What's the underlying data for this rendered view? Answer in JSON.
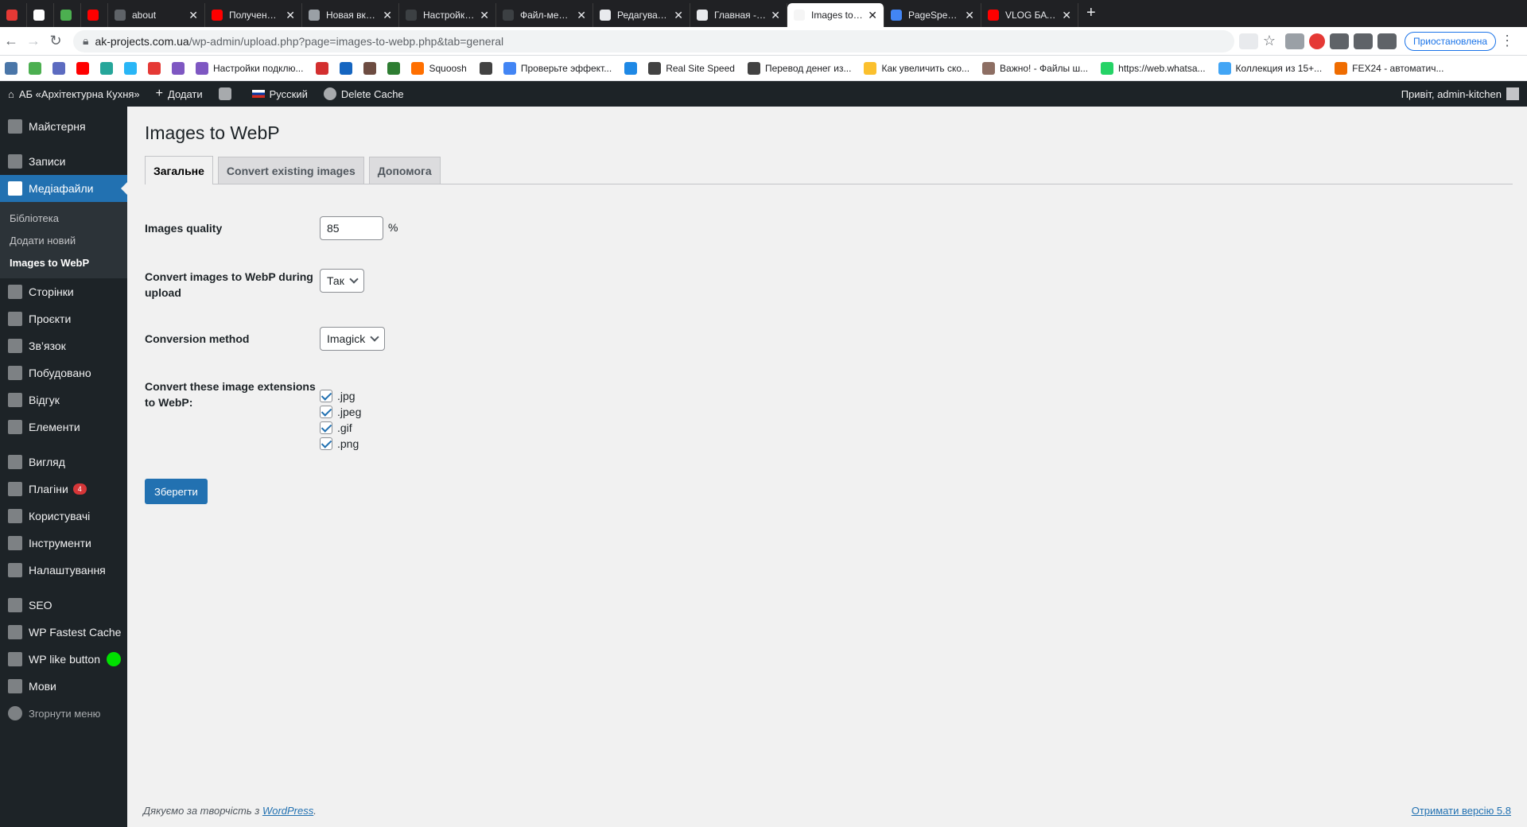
{
  "browser": {
    "tabs": [
      {
        "title": "",
        "color": "#e53935"
      },
      {
        "title": "",
        "color": "#fff"
      },
      {
        "title": "",
        "color": "#4caf50"
      },
      {
        "title": "",
        "color": "#ff0000"
      },
      {
        "title": "about",
        "color": "#5f6368"
      },
      {
        "title": "Получение и от",
        "color": "#ff0000"
      },
      {
        "title": "Новая вкладка",
        "color": "#9aa0a6"
      },
      {
        "title": "Настройка пар",
        "color": "#3c4043"
      },
      {
        "title": "Файл-менеджер",
        "color": "#3c4043"
      },
      {
        "title": "Редагувати тем",
        "color": "#e8eaed"
      },
      {
        "title": "Главная - АБ «А",
        "color": "#e8eaed"
      },
      {
        "title": "Images to WebP",
        "color": "#f5f5f5",
        "active": true
      },
      {
        "title": "PageSpeed Insi",
        "color": "#4285f4"
      },
      {
        "title": "VLOG БАТЯ РАС",
        "color": "#ff0000"
      }
    ],
    "url_host": "ak-projects.com.ua",
    "url_path": "/wp-admin/upload.php?page=images-to-webp.php&tab=general",
    "profile_label": "Приостановлена",
    "bookmarks": [
      {
        "label": "",
        "color": "#4a76a8"
      },
      {
        "label": "",
        "color": "#4caf50"
      },
      {
        "label": "",
        "color": "#5c6bc0"
      },
      {
        "label": "",
        "color": "#ff0000"
      },
      {
        "label": "",
        "color": "#26a69a"
      },
      {
        "label": "",
        "color": "#29b6f6"
      },
      {
        "label": "",
        "color": "#e53935"
      },
      {
        "label": "",
        "color": "#7e57c2"
      },
      {
        "label": "Настройки подклю...",
        "color": "#7e57c2"
      },
      {
        "label": "",
        "color": "#d32f2f"
      },
      {
        "label": "",
        "color": "#1565c0"
      },
      {
        "label": "",
        "color": "#6d4c41"
      },
      {
        "label": "",
        "color": "#2e7d32"
      },
      {
        "label": "Squoosh",
        "color": "#ff6f00"
      },
      {
        "label": "",
        "color": "#424242"
      },
      {
        "label": "Проверьте эффект...",
        "color": "#4285f4"
      },
      {
        "label": "",
        "color": "#1e88e5"
      },
      {
        "label": "Real Site Speed",
        "color": "#424242"
      },
      {
        "label": "Перевод денег из...",
        "color": "#424242"
      },
      {
        "label": "Как увеличить ско...",
        "color": "#fbc02d"
      },
      {
        "label": "Важно! - Файлы ш...",
        "color": "#8d6e63"
      },
      {
        "label": "https://web.whatsa...",
        "color": "#25d366"
      },
      {
        "label": "Коллекция из 15+...",
        "color": "#42a5f5"
      },
      {
        "label": "FEX24 - автоматич...",
        "color": "#ef6c00"
      }
    ]
  },
  "adminbar": {
    "site_name": "АБ «Архітектурна Кухня»",
    "add_new": "Додати",
    "language": "Русский",
    "delete_cache": "Delete Cache",
    "greeting": "Привіт, admin-kitchen"
  },
  "sidebar": {
    "dashboard": "Майстерня",
    "posts": "Записи",
    "media": "Медіафайли",
    "media_sub": [
      "Бібліотека",
      "Додати новий",
      "Images to WebP"
    ],
    "pages": "Сторінки",
    "projects": "Проєкти",
    "contact": "Зв’язок",
    "built": "Побудовано",
    "feedback": "Відгук",
    "elements": "Елементи",
    "appearance": "Вигляд",
    "plugins": "Плагіни",
    "plugins_badge": "4",
    "users": "Користувачі",
    "tools": "Інструменти",
    "settings": "Налаштування",
    "seo": "SEO",
    "fastest_cache": "WP Fastest Cache",
    "like_button": "WP like button",
    "languages": "Мови",
    "collapse": "Згорнути меню"
  },
  "page": {
    "title": "Images to WebP",
    "tabs": [
      "Загальне",
      "Convert existing images",
      "Допомога"
    ],
    "quality_label": "Images quality",
    "quality_value": "85",
    "quality_unit": "%",
    "upload_label": "Convert images to WebP during upload",
    "upload_value": "Так",
    "method_label": "Conversion method",
    "method_value": "Imagick",
    "ext_label": "Convert these image extensions to WebP:",
    "extensions": [
      ".jpg",
      ".jpeg",
      ".gif",
      ".png"
    ],
    "save_label": "Зберегти"
  },
  "footer": {
    "thanks": "Дякуємо за творчість з ",
    "wp_link": "WordPress",
    "dot": ".",
    "version": "Отримати версію 5.8"
  },
  "colors": {
    "admin_blue": "#2271b1",
    "admin_dark": "#1d2327"
  }
}
